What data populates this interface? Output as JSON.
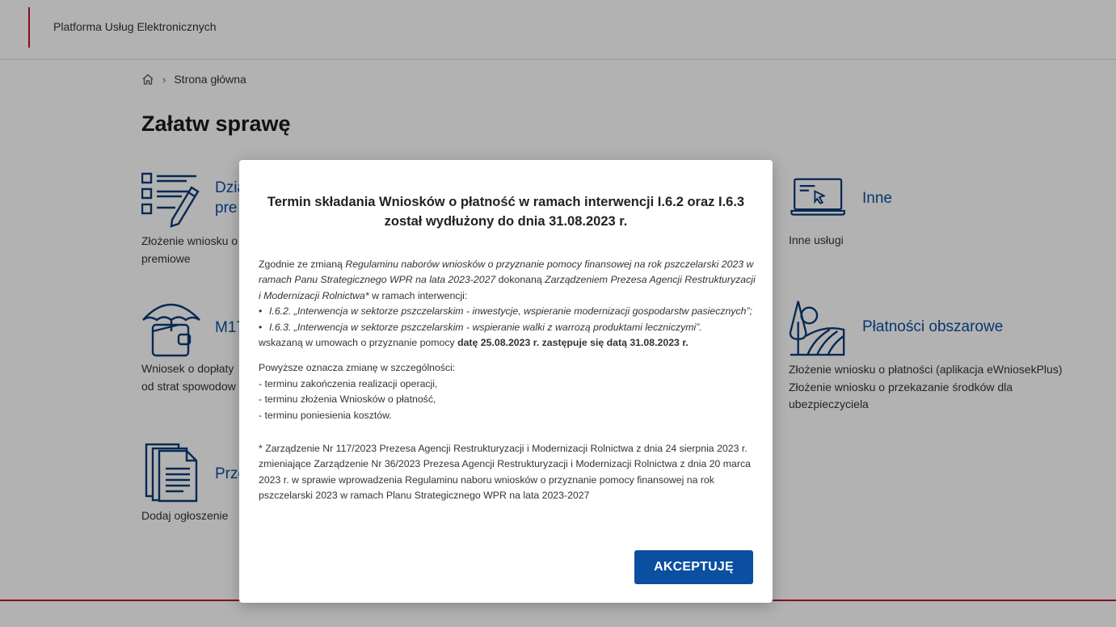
{
  "header": {
    "brand": "Platforma Usług Elektronicznych"
  },
  "breadcrumb": {
    "home_icon": "home-icon",
    "current": "Strona główna"
  },
  "page": {
    "title": "Załatw sprawę"
  },
  "tiles": [
    {
      "icon": "form-edit-icon",
      "title": "Dzia…\npre…",
      "title_line1": "Dzia",
      "title_line2": "pre",
      "desc_line1": "Złożenie wniosku o",
      "desc_line2": "premiowe"
    },
    {
      "icon": "umbrella-wallet-icon",
      "title_line1": "M17",
      "desc_line1": "Wniosek o dopłaty",
      "desc_line2": "od strat spowodow"
    },
    {
      "icon": "documents-icon",
      "title_line1": "Prze",
      "desc_line1": "Dodaj ogłoszenie"
    },
    {
      "icon": "laptop-cursor-icon",
      "title_line1": "Inne",
      "desc_line1": "Inne usługi"
    },
    {
      "icon": "field-tree-icon",
      "title_line1": "Płatności obszarowe",
      "desc_line1": "Złożenie wniosku o płatności (aplikacja eWniosekPlus)",
      "desc_line2": "Złożenie wniosku o przekazanie środków dla",
      "desc_line3": "ubezpieczyciela"
    }
  ],
  "modal": {
    "title_line1": "Termin składania Wniosków o płatność w ramach interwencji I.6.2 oraz I.6.3",
    "title_line2": "został wydłużony do dnia 31.08.2023 r.",
    "p1_a": "Zgodnie ze zmianą ",
    "p1_b": "Regulaminu naborów wniosków o przyznanie pomocy finansowej na rok pszczelarski 2023 w ramach Panu Strategicznego WPR na lata 2023-2027",
    "p1_c": " dokonaną ",
    "p1_d": "Zarządzeniem Prezesa Agencji Restrukturyzacji i Modernizacji Rolnictwa*",
    "p1_e": " w ramach interwencji:",
    "bullet1": "I.6.2. „Interwencja w sektorze pszczelarskim - inwestycje, wspieranie modernizacji gospodarstw pasiecznych”;",
    "bullet2": "I.6.3. „Interwencja w sektorze pszczelarskim - wspieranie walki z warrozą produktami leczniczymi”.",
    "p2_a": "wskazaną w umowach o przyznanie pomocy ",
    "p2_b": "datę 25.08.2023 r. zastępuje się datą 31.08.2023 r.",
    "p3": "Powyższe oznacza zmianę w szczególności:",
    "item1": "- terminu zakończenia realizacji operacji,",
    "item2": "- terminu złożenia Wniosków o płatność,",
    "item3": "- terminu poniesienia kosztów.",
    "footnote": "* Zarządzenie Nr 117/2023 Prezesa Agencji Restrukturyzacji i Modernizacji Rolnictwa z dnia 24 sierpnia 2023 r. zmieniające Zarządzenie Nr 36/2023 Prezesa Agencji Restrukturyzacji i Modernizacji Rolnictwa z dnia 20 marca 2023 r. w sprawie wprowadzenia Regulaminu naboru wniosków o przyznanie pomocy finansowej na rok pszczelarski 2023 w ramach Planu Strategicznego WPR na lata 2023-2027",
    "accept_label": "AKCEPTUJĘ"
  },
  "colors": {
    "accent": "#0a4fa0",
    "brand_red": "#c8102e"
  }
}
